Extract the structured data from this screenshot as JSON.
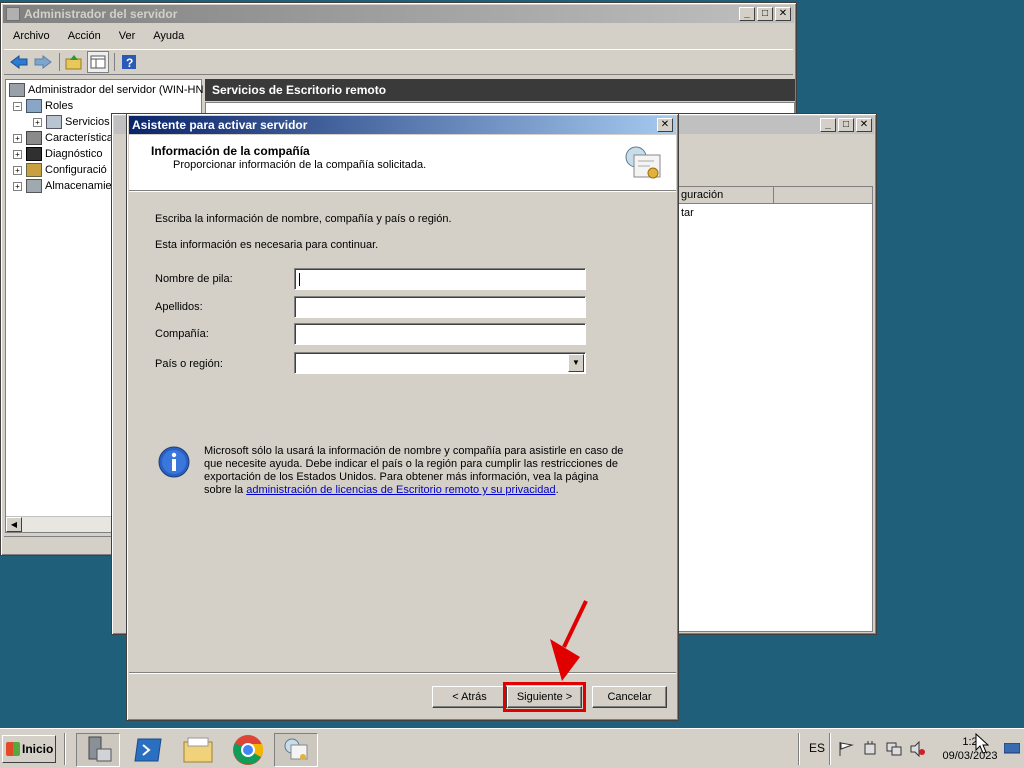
{
  "server_manager": {
    "title": "Administrador del servidor",
    "menu": [
      "Archivo",
      "Acción",
      "Ver",
      "Ayuda"
    ],
    "tree": {
      "root": "Administrador del servidor (WIN-HN",
      "roles": "Roles",
      "services": "Servicios",
      "features": "Característica",
      "diagnostics": "Diagnóstico",
      "configuration": "Configuració",
      "storage": "Almacenamie"
    },
    "panel_title": "Servicios de Escritorio remoto"
  },
  "back_window": {
    "column_header": "guración",
    "row_text": "tar"
  },
  "wizard": {
    "title": "Asistente para activar servidor",
    "header_title": "Información de la compañía",
    "header_subtitle": "Proporcionar información de la compañía solicitada.",
    "intro1": "Escriba la información de nombre, compañía y país o región.",
    "intro2": "Esta información es necesaria para continuar.",
    "fields": {
      "first_name_label": "Nombre de pila:",
      "last_name_label": "Apellidos:",
      "company_label": "Compañía:",
      "country_label": "País o región:",
      "first_name_value": "",
      "last_name_value": "",
      "company_value": "",
      "country_value": ""
    },
    "info_text": "Microsoft sólo la usará la información de nombre y compañía para asistirle en caso de que necesite ayuda. Debe indicar el país o la región para cumplir las restricciones de exportación de los Estados Unidos. Para obtener más información, vea la página sobre la ",
    "info_link": "administración de licencias de Escritorio remoto y su privacidad",
    "info_end": ".",
    "buttons": {
      "back": "< Atrás",
      "next": "Siguiente >",
      "cancel": "Cancelar"
    }
  },
  "taskbar": {
    "start": "Inicio",
    "language": "ES",
    "time": "1:2",
    "date": "09/03/2023"
  },
  "colors": {
    "desktop": "#1f5f7a",
    "highlight": "#e00000",
    "link": "#0000cc"
  }
}
